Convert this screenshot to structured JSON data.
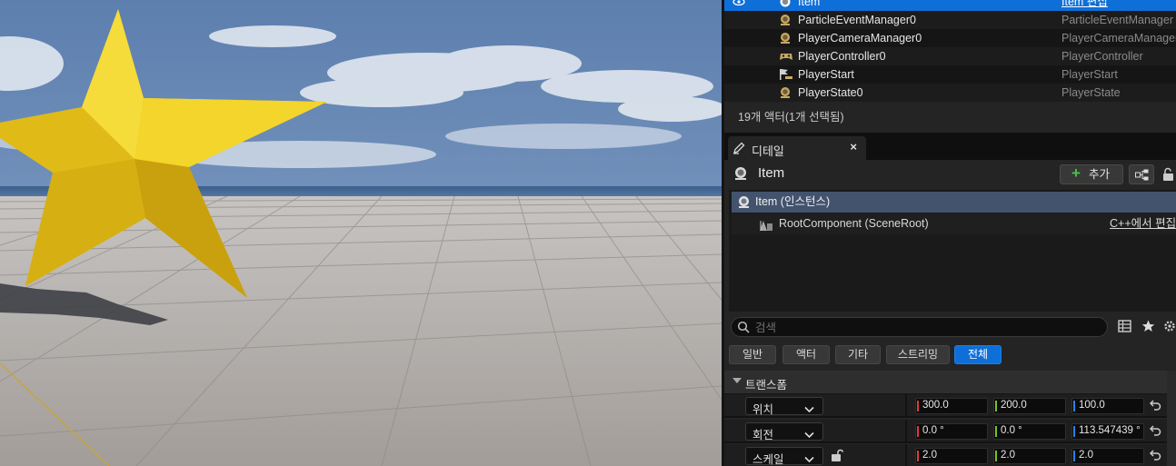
{
  "outliner": {
    "rows": [
      {
        "name": "Item",
        "type": "Item 편집",
        "selected": true,
        "icon": "actor-icon"
      },
      {
        "name": "ParticleEventManager0",
        "type": "ParticleEventManager",
        "icon": "actor-icon"
      },
      {
        "name": "PlayerCameraManager0",
        "type": "PlayerCameraManager",
        "icon": "actor-icon"
      },
      {
        "name": "PlayerController0",
        "type": "PlayerController",
        "icon": "gamepad-icon"
      },
      {
        "name": "PlayerStart",
        "type": "PlayerStart",
        "icon": "flag-icon"
      },
      {
        "name": "PlayerState0",
        "type": "PlayerState",
        "icon": "actor-icon"
      }
    ],
    "footer": "19개 액터(1개 선택됨)"
  },
  "details": {
    "tab_label": "디테일",
    "close_glyph": "×",
    "object_name": "Item",
    "add_label": "추가",
    "components": {
      "instance_label": "Item (인스턴스)",
      "root_label": "RootComponent (SceneRoot)",
      "edit_link": "C++에서 편집"
    },
    "search": {
      "placeholder": "검색"
    },
    "filters": [
      "일반",
      "액터",
      "기타",
      "스트리밍",
      "전체"
    ],
    "active_filter": "전체",
    "transform": {
      "category": "트랜스폼",
      "location_label": "위치",
      "rotation_label": "회전",
      "scale_label": "스케일",
      "location": [
        "300.0",
        "200.0",
        "100.0"
      ],
      "rotation": [
        "0.0 °",
        "0.0 °",
        "113.547439 °"
      ],
      "scale": [
        "2.0",
        "2.0",
        "2.0"
      ]
    }
  },
  "colors": {
    "selection": "#0e6fd8",
    "axis_x": "#e23a3a",
    "axis_y": "#74c12b",
    "axis_z": "#2f7fe8",
    "star": "#f0cf1c",
    "add_plus": "#46c34a"
  }
}
